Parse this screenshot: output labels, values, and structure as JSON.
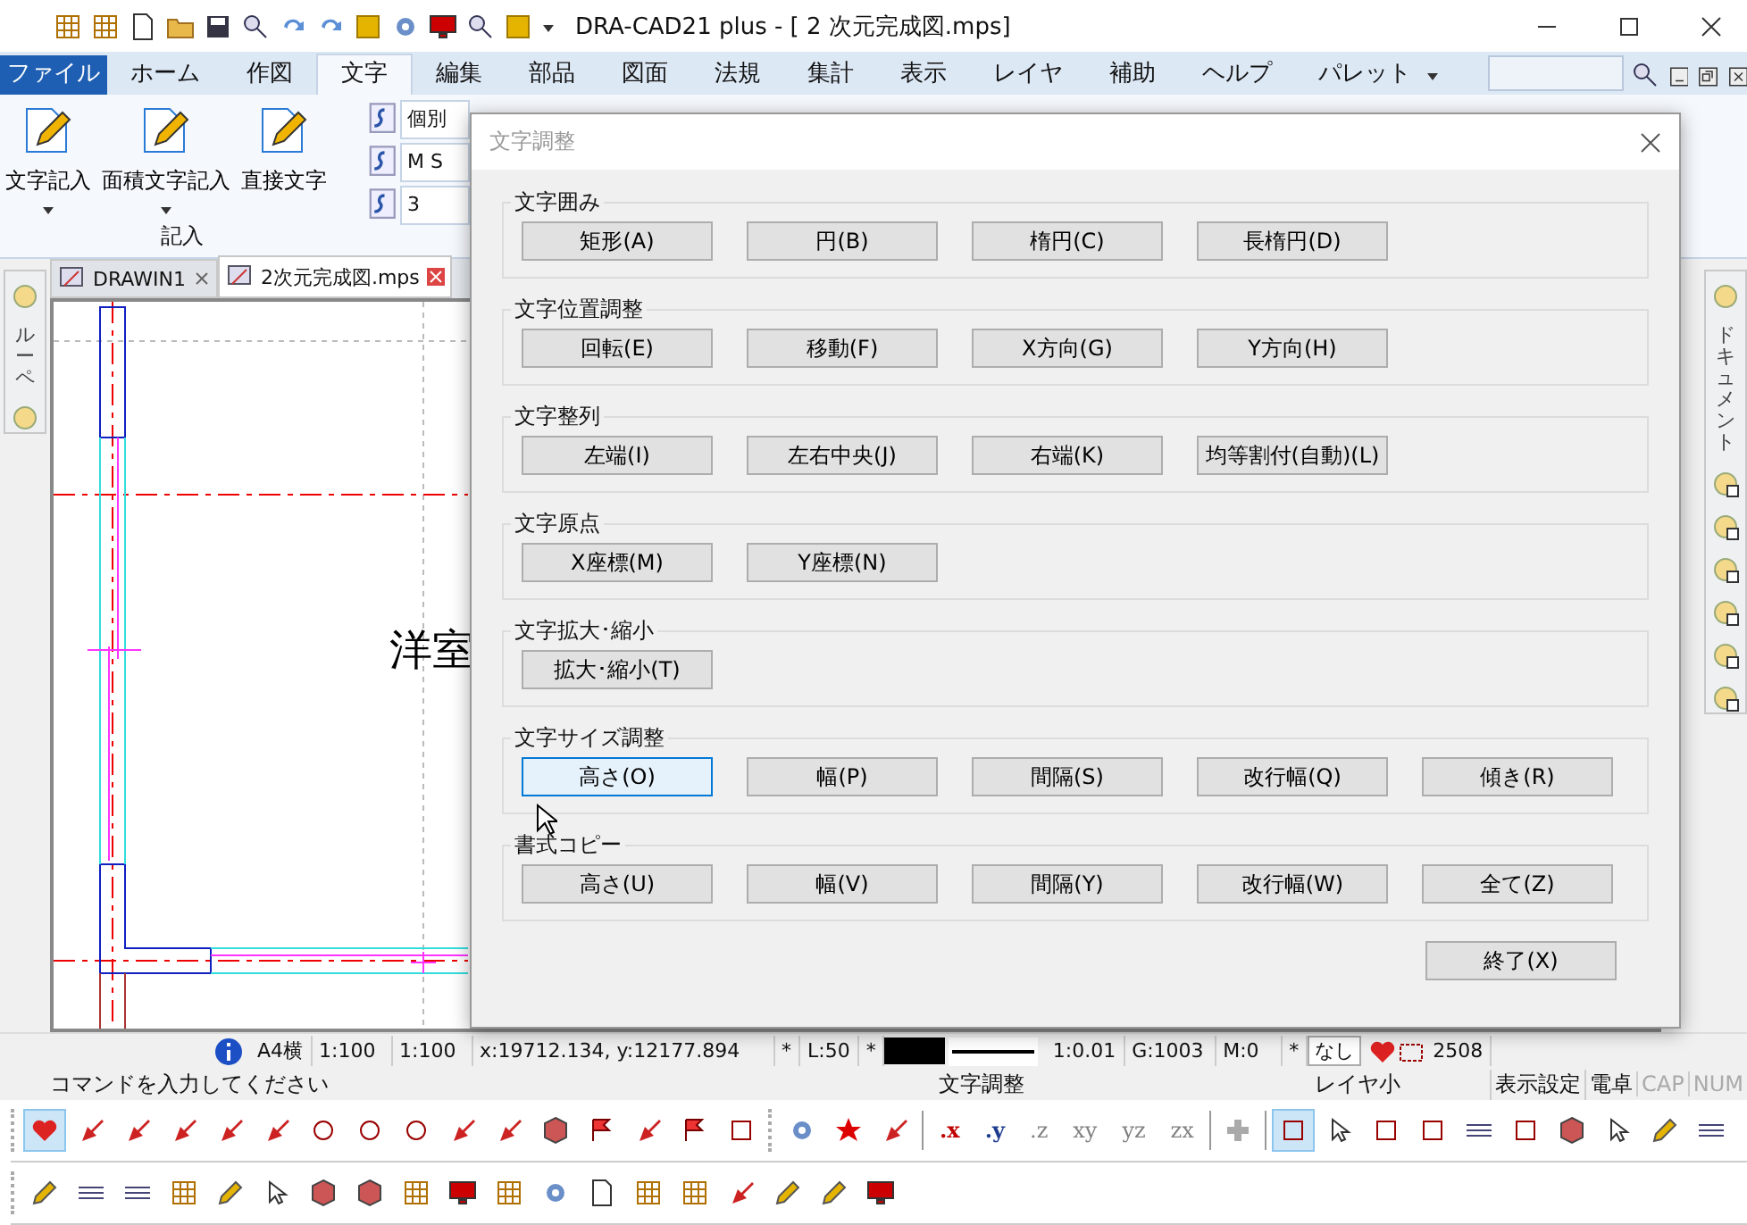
{
  "window": {
    "title": "DRA-CAD21 plus - [ 2 次元完成図.mps]"
  },
  "menu_tabs": [
    {
      "label": "ファイル",
      "kind": "file",
      "selected": false
    },
    {
      "label": "ホーム",
      "kind": "tab",
      "selected": false
    },
    {
      "label": "作図",
      "kind": "tab",
      "selected": false
    },
    {
      "label": "文字",
      "kind": "tab",
      "selected": true
    },
    {
      "label": "編集",
      "kind": "tab",
      "selected": false
    },
    {
      "label": "部品",
      "kind": "tab",
      "selected": false
    },
    {
      "label": "図面",
      "kind": "tab",
      "selected": false
    },
    {
      "label": "法規",
      "kind": "tab",
      "selected": false
    },
    {
      "label": "集計",
      "kind": "tab",
      "selected": false
    },
    {
      "label": "表示",
      "kind": "tab",
      "selected": false
    },
    {
      "label": "レイヤ",
      "kind": "tab",
      "selected": false
    },
    {
      "label": "補助",
      "kind": "tab",
      "selected": false
    },
    {
      "label": "ヘルプ",
      "kind": "tab",
      "selected": false
    },
    {
      "label": "パレット",
      "kind": "dropdown",
      "selected": false
    }
  ],
  "ribbon": {
    "buttons": [
      {
        "label": "文字記入",
        "dropdown": true
      },
      {
        "label": "面積文字記入",
        "dropdown": true
      },
      {
        "label": "直接文字",
        "dropdown": false
      }
    ],
    "group_label": "記入",
    "style_fields": [
      {
        "value": "個別"
      },
      {
        "value": "M S"
      },
      {
        "value": "3"
      }
    ]
  },
  "doc_tabs": [
    {
      "label": "DRAWIN1",
      "selected": false
    },
    {
      "label": "2次元完成図.mps",
      "selected": true
    }
  ],
  "left_panel": {
    "label": "ルーペ"
  },
  "right_panel": {
    "label": "ドキュメント"
  },
  "canvas": {
    "room_label": "洋室"
  },
  "status_bar": {
    "paper": "A4横",
    "scale_1": "1:100",
    "scale_2": "1:100",
    "coords": "x:19712.134, y:12177.894",
    "layer_mark": "*",
    "layer": "L:50",
    "color_mark": "*",
    "ratio": "1:0.01",
    "group": "G:1003",
    "mode": "M:0",
    "line_mark": "*",
    "line_type": "なし",
    "count": "2508"
  },
  "command_bar": {
    "prompt": "コマンドを入力してください",
    "current_command": "文字調整",
    "layer_size": "レイヤ小",
    "display_settings": "表示設定",
    "calculator": "電卓",
    "indicators": [
      {
        "label": "CAP",
        "on": false
      },
      {
        "label": "NUM",
        "on": false
      }
    ]
  },
  "toolbar": {
    "axis_buttons": [
      {
        "label": ".x",
        "disabled": false,
        "color": "#c00000"
      },
      {
        "label": ".y",
        "disabled": false,
        "color": "#1f3d8f"
      },
      {
        "label": ".z",
        "disabled": true,
        "color": "#808080"
      },
      {
        "label": "xy",
        "disabled": true,
        "color": "#808080"
      },
      {
        "label": "yz",
        "disabled": true,
        "color": "#808080"
      },
      {
        "label": "zx",
        "disabled": true,
        "color": "#808080"
      }
    ]
  },
  "dialog": {
    "title": "文字調整",
    "groups": [
      {
        "label": "文字囲み",
        "buttons": [
          {
            "label": "矩形(A)",
            "focused": false
          },
          {
            "label": "円(B)",
            "focused": false
          },
          {
            "label": "楕円(C)",
            "focused": false
          },
          {
            "label": "長楕円(D)",
            "focused": false
          }
        ]
      },
      {
        "label": "文字位置調整",
        "buttons": [
          {
            "label": "回転(E)",
            "focused": false
          },
          {
            "label": "移動(F)",
            "focused": false
          },
          {
            "label": "X方向(G)",
            "focused": false
          },
          {
            "label": "Y方向(H)",
            "focused": false
          }
        ]
      },
      {
        "label": "文字整列",
        "buttons": [
          {
            "label": "左端(I)",
            "focused": false
          },
          {
            "label": "左右中央(J)",
            "focused": false
          },
          {
            "label": "右端(K)",
            "focused": false
          },
          {
            "label": "均等割付(自動)(L)",
            "focused": false
          }
        ]
      },
      {
        "label": "文字原点",
        "buttons": [
          {
            "label": "X座標(M)",
            "focused": false
          },
          {
            "label": "Y座標(N)",
            "focused": false
          }
        ]
      },
      {
        "label": "文字拡大･縮小",
        "buttons": [
          {
            "label": "拡大･縮小(T)",
            "focused": false
          }
        ]
      },
      {
        "label": "文字サイズ調整",
        "buttons": [
          {
            "label": "高さ(O)",
            "focused": true
          },
          {
            "label": "幅(P)",
            "focused": false
          },
          {
            "label": "間隔(S)",
            "focused": false
          },
          {
            "label": "改行幅(Q)",
            "focused": false
          },
          {
            "label": "傾き(R)",
            "focused": false
          }
        ]
      },
      {
        "label": "書式コピー",
        "buttons": [
          {
            "label": "高さ(U)",
            "focused": false
          },
          {
            "label": "幅(V)",
            "focused": false
          },
          {
            "label": "間隔(Y)",
            "focused": false
          },
          {
            "label": "改行幅(W)",
            "focused": false
          },
          {
            "label": "全て(Z)",
            "focused": false
          }
        ]
      }
    ],
    "close_button": "終了(X)"
  }
}
